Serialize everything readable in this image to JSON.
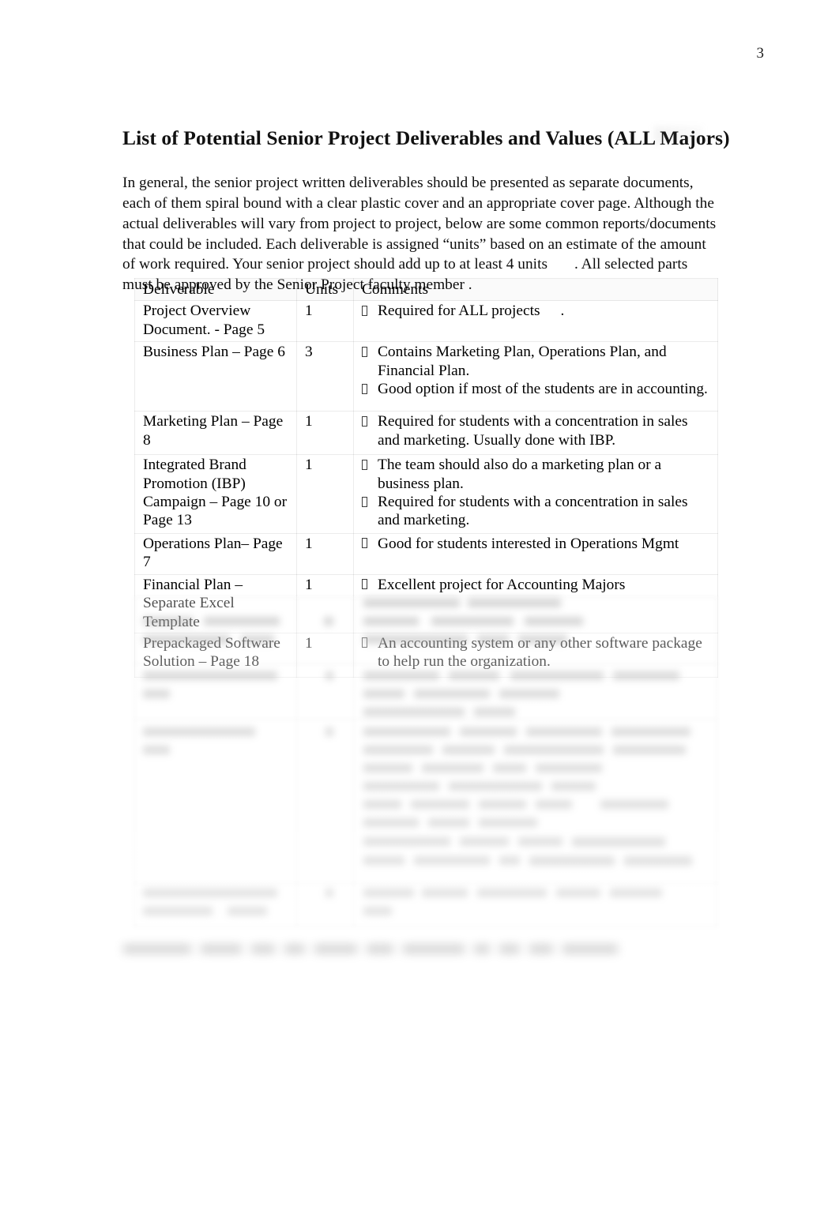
{
  "page": {
    "number": "3",
    "paper_color": "#ffffff",
    "text_color": "#000000"
  },
  "title": "List of Potential Senior Project Deliverables and Values (ALL Majors)",
  "intro": {
    "part1": "In general, the senior project written deliverables should be presented as separate documents, each of them spiral bound with a clear plastic cover and an appropriate cover page.   Although the actual deliverables will vary from project to project, below are some common reports/documents that could be included.  Each deliverable is assigned “units” based on an estimate of the amount of work required.  Your senior project should add up to at least 4 units",
    "part2": ".  All selected parts must be approved by the Senior Project faculty member  ."
  },
  "table": {
    "headers": {
      "deliverable": "Deliverable",
      "units": "Units",
      "comments": "Comments"
    },
    "rows": [
      {
        "deliverable": "Project Overview Document. -    Page 5",
        "units": "1",
        "comments": [
          "Required for ALL projects"
        ],
        "comments_trailing": "."
      },
      {
        "deliverable": "Business Plan – Page 6",
        "units": "3",
        "comments": [
          "Contains Marketing Plan, Operations Plan, and Financial Plan.",
          "Good option if most of the students are in accounting."
        ]
      },
      {
        "deliverable": "Marketing Plan – Page 8",
        "units": "1",
        "comments": [
          "Required for students with a concentration in sales and marketing. Usually done with IBP."
        ]
      },
      {
        "deliverable": "Integrated Brand Promotion (IBP) Campaign – Page 10 or Page 13",
        "units": "1",
        "comments": [
          "The team should also do a marketing plan or a business plan.",
          "Required for students with a concentration in sales and marketing."
        ]
      },
      {
        "deliverable": "Operations Plan– Page 7",
        "units": "1",
        "comments": [
          "Good for students interested in Operations Mgmt"
        ]
      },
      {
        "deliverable": "Financial Plan – Separate Excel Template",
        "units": "1",
        "comments": [
          "Excellent project for Accounting Majors"
        ]
      },
      {
        "deliverable": "Prepackaged Software Solution – Page 18",
        "units": "1",
        "comments": [
          "An accounting system or any other software package to help run the organization."
        ]
      }
    ],
    "illegible_note": "Remaining table rows and the closing line below the table are blurred beyond legibility in the source image."
  },
  "bullet_glyph": "missing-glyph-box"
}
